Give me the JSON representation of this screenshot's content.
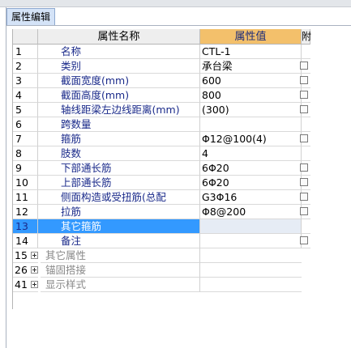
{
  "tab_title": "属性编辑",
  "columns": {
    "name": "属性名称",
    "value": "属性值",
    "attach": "附"
  },
  "rows": [
    {
      "num": "1",
      "name": "名称",
      "value": "CTL-1",
      "checkbox": false
    },
    {
      "num": "2",
      "name": "类别",
      "value": "承台梁",
      "checkbox": true
    },
    {
      "num": "3",
      "name": "截面宽度(mm)",
      "value": "600",
      "checkbox": true
    },
    {
      "num": "4",
      "name": "截面高度(mm)",
      "value": "800",
      "checkbox": true
    },
    {
      "num": "5",
      "name": "轴线距梁左边线距离(mm)",
      "value": "(300)",
      "checkbox": true
    },
    {
      "num": "6",
      "name": "跨数量",
      "value": "",
      "checkbox": false
    },
    {
      "num": "7",
      "name": "箍筋",
      "value": "Φ12@100(4)",
      "checkbox": true
    },
    {
      "num": "8",
      "name": "肢数",
      "value": "4",
      "checkbox": false
    },
    {
      "num": "9",
      "name": "下部通长筋",
      "value": "6Φ20",
      "checkbox": true
    },
    {
      "num": "10",
      "name": "上部通长筋",
      "value": "6Φ20",
      "checkbox": true
    },
    {
      "num": "11",
      "name": "侧面构造或受扭筋(总配",
      "value": "G3Φ16",
      "checkbox": true
    },
    {
      "num": "12",
      "name": "拉筋",
      "value": "Φ8@200",
      "checkbox": true
    },
    {
      "num": "13",
      "name": "其它箍筋",
      "value": "",
      "checkbox": false,
      "selected": true
    },
    {
      "num": "14",
      "name": "备注",
      "value": "",
      "checkbox": true
    }
  ],
  "groups": [
    {
      "num": "15",
      "name": "其它属性"
    },
    {
      "num": "26",
      "name": "锚固搭接"
    },
    {
      "num": "41",
      "name": "显示样式"
    }
  ]
}
